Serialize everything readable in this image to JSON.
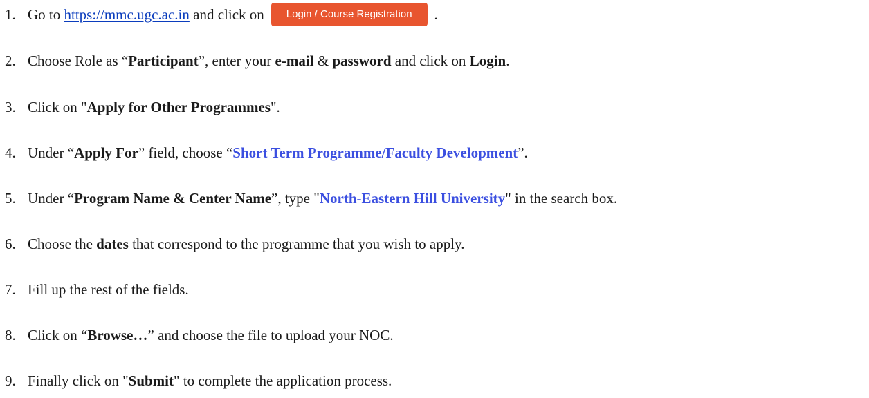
{
  "steps": [
    {
      "num": "1.",
      "pre": "Go to ",
      "link": "https://mmc.ugc.ac.in",
      "mid": " and click on",
      "button": "Login / Course Registration",
      "post": "."
    },
    {
      "num": "2.",
      "a": "Choose Role as “",
      "b": "Participant",
      "c": "”, enter your ",
      "d": "e-mail",
      "e": " & ",
      "f": "password",
      "g": " and click on ",
      "h": "Login",
      "i": "."
    },
    {
      "num": "3.",
      "a": "Click on \"",
      "b": "Apply for Other Programmes",
      "c": "\"."
    },
    {
      "num": "4.",
      "a": "Under “",
      "b": "Apply For",
      "c": "” field, choose “",
      "d": "Short Term Programme/Faculty Development",
      "e": "”."
    },
    {
      "num": "5.",
      "a": "Under “",
      "b": "Program Name & Center Name",
      "c": "”, type \"",
      "d": "North-Eastern Hill University",
      "e": "\" in the search box."
    },
    {
      "num": "6.",
      "a": "Choose the ",
      "b": "dates",
      "c": " that correspond to the programme that you wish to apply."
    },
    {
      "num": "7.",
      "a": "Fill up the rest of the fields."
    },
    {
      "num": "8.",
      "a": "Click on “",
      "b": "Browse…",
      "c": "” and choose the file to upload your NOC."
    },
    {
      "num": "9.",
      "a": "Finally click on \"",
      "b": "Submit",
      "c": "\" to complete the application process."
    }
  ],
  "colors": {
    "button_bg": "#e8552f",
    "highlight_blue": "#3b4fe0",
    "link": "#0b3dbd"
  }
}
